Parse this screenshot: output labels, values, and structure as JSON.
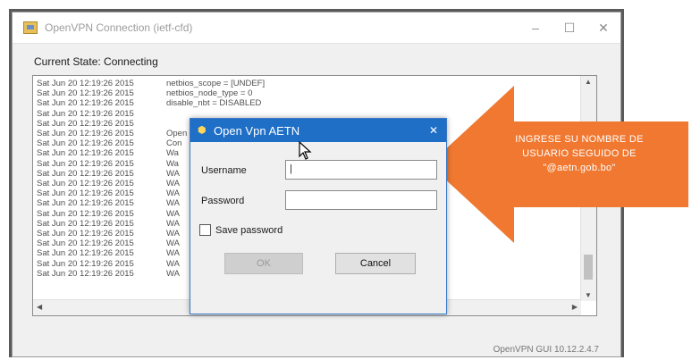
{
  "window": {
    "title": "OpenVPN Connection (ietf-cfd)",
    "state_label": "Current State: Connecting",
    "controls": {
      "minimize": "–",
      "maximize": "☐",
      "close": "✕"
    }
  },
  "log": {
    "lines": [
      {
        "ts": "Sat Jun 20 12:19:26 2015",
        "msg": "netbios_scope = [UNDEF]"
      },
      {
        "ts": "Sat Jun 20 12:19:26 2015",
        "msg": "netbios_node_type = 0"
      },
      {
        "ts": "Sat Jun 20 12:19:26 2015",
        "msg": "disable_nbt = DISABLED"
      },
      {
        "ts": "Sat Jun 20 12:19:26 2015",
        "msg": ""
      },
      {
        "ts": "Sat Jun 20 12:19:26 2015",
        "msg": ""
      },
      {
        "ts": "Sat Jun 20 12:19:26 2015",
        "msg": "Open"
      },
      {
        "ts": "Sat Jun 20 12:19:26 2015",
        "msg": "Con"
      },
      {
        "ts": "Sat Jun 20 12:19:26 2015",
        "msg": "Wa"
      },
      {
        "ts": "Sat Jun 20 12:19:26 2015",
        "msg": "Wa"
      },
      {
        "ts": "Sat Jun 20 12:19:26 2015",
        "msg": "WA"
      },
      {
        "ts": "Sat Jun 20 12:19:26 2015",
        "msg": "WA"
      },
      {
        "ts": "Sat Jun 20 12:19:26 2015",
        "msg": "WA"
      },
      {
        "ts": "Sat Jun 20 12:19:26 2015",
        "msg": "WA"
      },
      {
        "ts": "Sat Jun 20 12:19:26 2015",
        "msg": "WA"
      },
      {
        "ts": "Sat Jun 20 12:19:26 2015",
        "msg": "WA"
      },
      {
        "ts": "Sat Jun 20 12:19:26 2015",
        "msg": "WA"
      },
      {
        "ts": "Sat Jun 20 12:19:26 2015",
        "msg": "WA"
      },
      {
        "ts": "Sat Jun 20 12:19:26 2015",
        "msg": "WA"
      },
      {
        "ts": "Sat Jun 20 12:19:26 2015",
        "msg": "WA"
      },
      {
        "ts": "Sat Jun 20 12:19:26 2015",
        "msg": "WA"
      }
    ]
  },
  "status_bottom": "OpenVPN GUI 10.12.2.4.7",
  "dialog": {
    "title": "Open Vpn AETN",
    "close": "✕",
    "username_label": "Username",
    "username_value": "|",
    "password_label": "Password",
    "password_value": "",
    "save_password_label": "Save password",
    "ok_label": "OK",
    "cancel_label": "Cancel"
  },
  "callout": {
    "line1": "INGRESE SU NOMBRE DE",
    "line2": "USUARIO SEGUIDO DE",
    "line3": "\"@aetn.gob.bo\"",
    "color": "#f07830"
  }
}
